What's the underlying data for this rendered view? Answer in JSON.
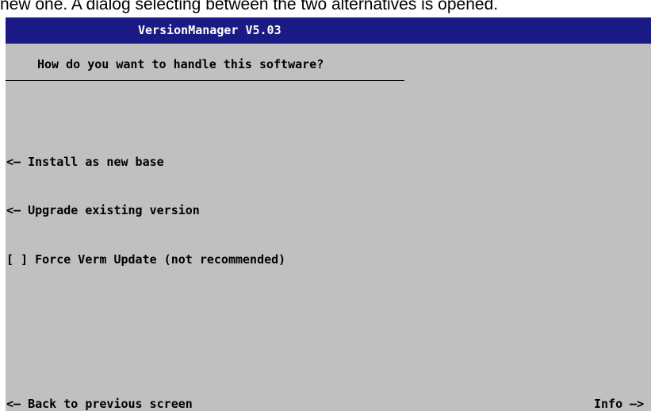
{
  "caption": "new one. A dialog selecting between the two alternatives is opened.",
  "title": "VersionManager V5.03",
  "question": "How do you want to handle this software?",
  "options": {
    "install": {
      "arrow": "<—",
      "label": "Install as new base"
    },
    "upgrade": {
      "arrow": "<—",
      "label": "Upgrade existing version"
    },
    "force": {
      "checkbox": "[ ]",
      "label": "Force Verm Update (not recommended)",
      "checked": false
    }
  },
  "footer": {
    "back": {
      "arrow": "<—",
      "label": "Back to previous screen"
    },
    "info": {
      "label": "Info",
      "arrow": "—>"
    }
  },
  "colors": {
    "screen_background": "#c0c0c0",
    "titlebar_background": "#1a1a84",
    "titlebar_text": "#ffffff",
    "text": "#000000"
  }
}
